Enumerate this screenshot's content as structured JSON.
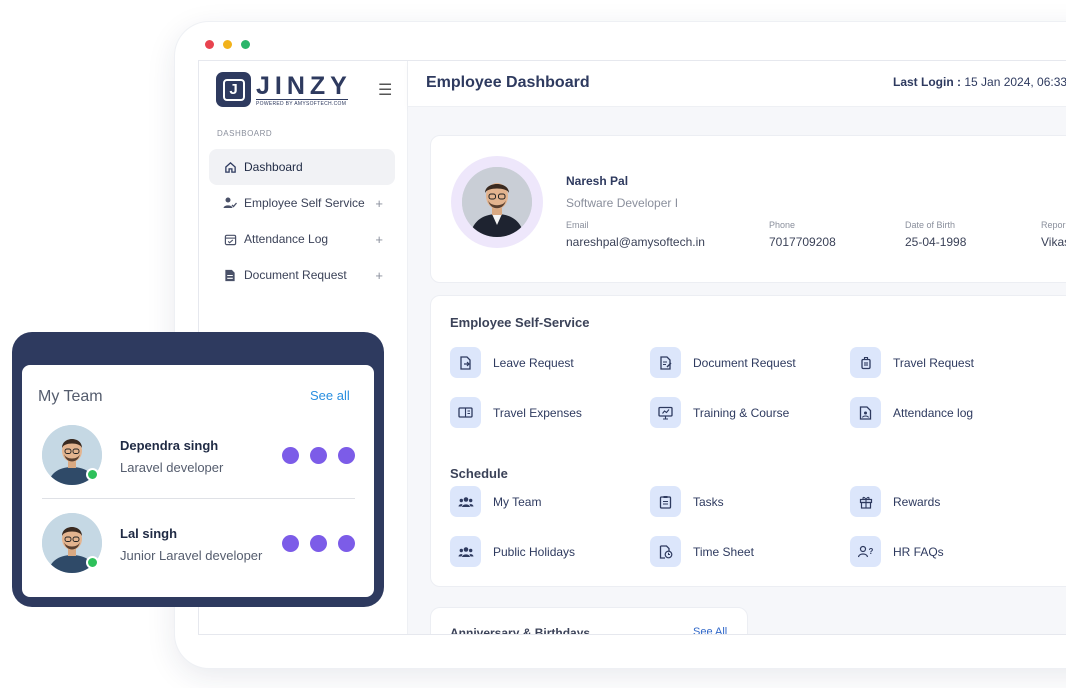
{
  "window": {
    "dot_colors": [
      "#e8434f",
      "#f2b21b",
      "#2ab56a"
    ]
  },
  "brand": {
    "mark": "J",
    "name": "JINZY",
    "tagline": "POWERED BY AMYSOFTECH.COM"
  },
  "sidebar": {
    "section_label": "DASHBOARD",
    "items": [
      {
        "label": "Dashboard",
        "icon": "home-icon",
        "active": true
      },
      {
        "label": "Employee Self Service",
        "icon": "user-check-icon",
        "expandable": true
      },
      {
        "label": "Attendance Log",
        "icon": "calendar-check-icon",
        "expandable": true
      },
      {
        "label": "Document Request",
        "icon": "document-icon",
        "expandable": true
      }
    ]
  },
  "header": {
    "title": "Employee Dashboard",
    "last_login_label": "Last Login :",
    "last_login_value": " 15 Jan 2024, 06:33"
  },
  "profile": {
    "name": "Naresh Pal",
    "role": "Software Developer I",
    "fields": [
      {
        "label": "Email",
        "value": "nareshpal@amysoftech.in"
      },
      {
        "label": "Phone",
        "value": "7017709208"
      },
      {
        "label": "Date of Birth",
        "value": "25-04-1998"
      },
      {
        "label": "Repor",
        "value": "Vikas"
      }
    ]
  },
  "self_service": {
    "title": "Employee Self-Service",
    "items": [
      {
        "label": "Leave Request",
        "icon": "leave-request-icon"
      },
      {
        "label": "Document Request",
        "icon": "document-edit-icon"
      },
      {
        "label": "Travel Request",
        "icon": "luggage-icon"
      },
      {
        "label": "Travel Expenses",
        "icon": "wallet-icon"
      },
      {
        "label": "Training & Course",
        "icon": "presentation-icon"
      },
      {
        "label": "Attendance log",
        "icon": "attendance-icon"
      }
    ]
  },
  "schedule": {
    "title": "Schedule",
    "items": [
      {
        "label": "My Team",
        "icon": "team-icon"
      },
      {
        "label": "Tasks",
        "icon": "tasks-icon"
      },
      {
        "label": "Rewards",
        "icon": "gift-icon"
      },
      {
        "label": "Public Holidays",
        "icon": "team-icon"
      },
      {
        "label": "Time Sheet",
        "icon": "timesheet-icon"
      },
      {
        "label": "HR FAQs",
        "icon": "faq-icon"
      }
    ]
  },
  "anniversary": {
    "title": "Anniversary & Birthdays",
    "see_all": "See All"
  },
  "my_team": {
    "title": "My Team",
    "see_all": "See all",
    "members": [
      {
        "name": "Dependra singh",
        "role": "Laravel developer",
        "online": true
      },
      {
        "name": "Lal singh",
        "role": "Junior Laravel developer",
        "online": true
      }
    ],
    "dot_color": "#7c5ce8",
    "online_color": "#2ec05a"
  }
}
